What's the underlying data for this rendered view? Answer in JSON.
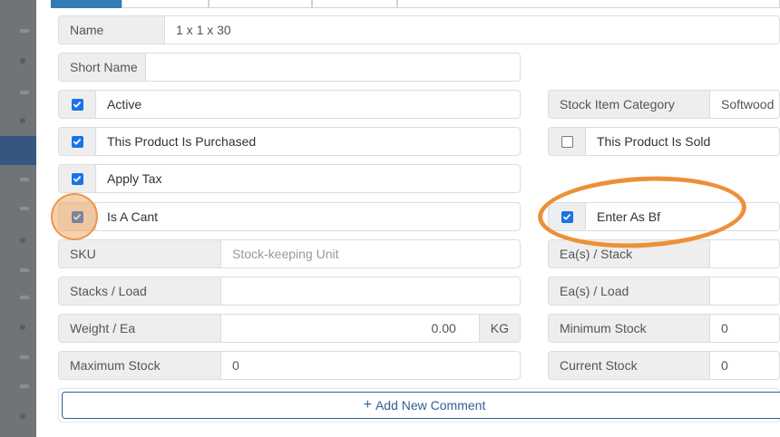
{
  "form": {
    "name": {
      "label": "Name",
      "value": "1 x 1 x 30"
    },
    "short_name": {
      "label": "Short Name",
      "value": ""
    },
    "active": {
      "label": "Active",
      "checked": true
    },
    "purchased": {
      "label": "This Product Is Purchased",
      "checked": true
    },
    "apply_tax": {
      "label": "Apply Tax",
      "checked": true
    },
    "is_a_cant": {
      "label": "Is A Cant",
      "checked": true
    },
    "sku": {
      "label": "SKU",
      "placeholder": "Stock-keeping Unit"
    },
    "stacks_load": {
      "label": "Stacks / Load",
      "value": ""
    },
    "weight_ea": {
      "label": "Weight / Ea",
      "value": "0.00",
      "unit": "KG"
    },
    "maximum_stock": {
      "label": "Maximum Stock",
      "value": "0"
    },
    "stock_item_category": {
      "label": "Stock Item Category",
      "value": "Softwood"
    },
    "sold": {
      "label": "This Product Is Sold",
      "checked": false
    },
    "enter_as_bf": {
      "label": "Enter As Bf",
      "checked": true
    },
    "eas_stack": {
      "label": "Ea(s) / Stack",
      "value": ""
    },
    "eas_load": {
      "label": "Ea(s) / Load",
      "value": ""
    },
    "minimum_stock": {
      "label": "Minimum Stock",
      "value": "0"
    },
    "current_stock": {
      "label": "Current Stock",
      "value": "0"
    }
  },
  "actions": {
    "add_comment": "Add New Comment"
  },
  "colors": {
    "checkbox": "#1a73e8",
    "highlight": "#ee8f39",
    "tab_active": "#337ab7"
  }
}
